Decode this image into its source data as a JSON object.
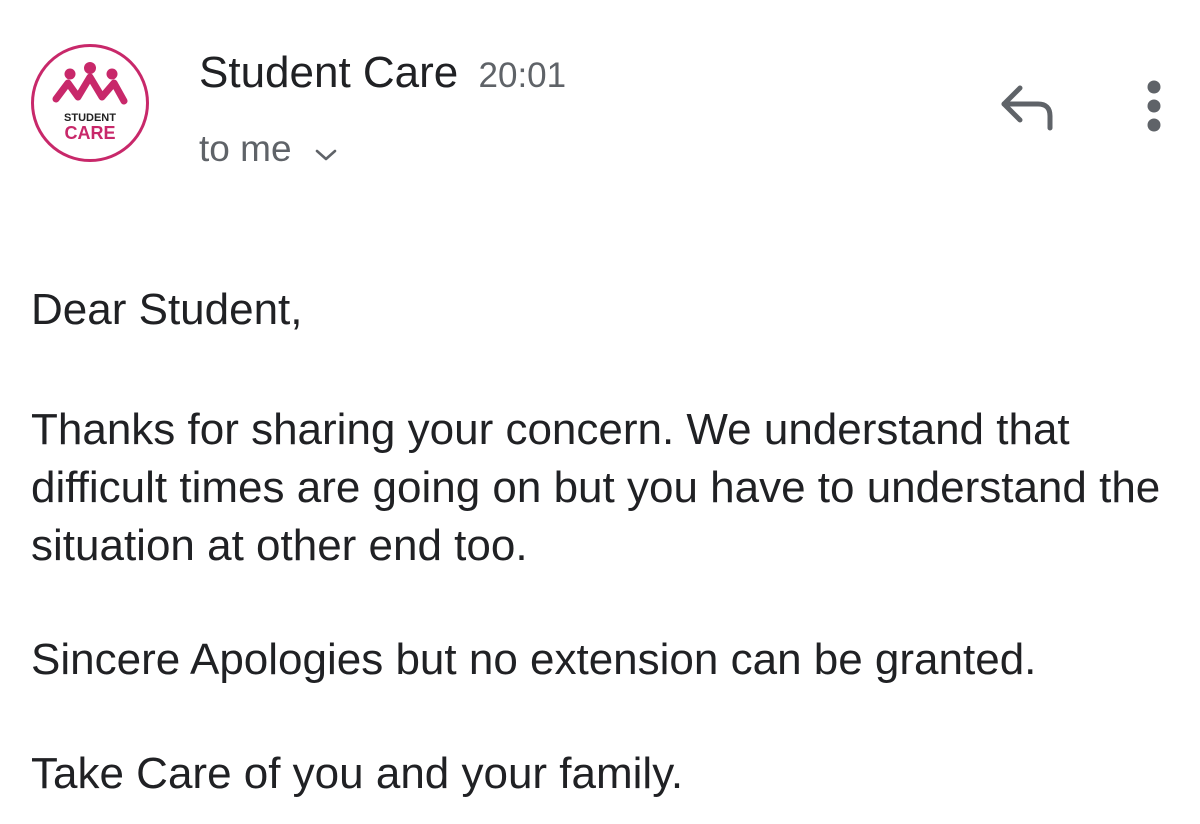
{
  "email": {
    "sender": {
      "name": "Student Care",
      "time": "20:01",
      "avatar": {
        "logo_text_top": "STUDENT",
        "logo_text_bottom": "CARE",
        "brand_color": "#c8286a"
      }
    },
    "recipient_label": "to me",
    "actions": {
      "reply_icon": "reply-icon",
      "more_icon": "more-vertical-icon",
      "expand_icon": "chevron-down-icon"
    },
    "body": {
      "greeting": "Dear Student,",
      "paragraph_main": "Thanks for sharing your concern. We understand that difficult times are going on but you have to understand the situation at other end too.",
      "paragraph_apology": "Sincere Apologies but no extension can be granted.",
      "closing": "Take Care of you and your family."
    }
  }
}
